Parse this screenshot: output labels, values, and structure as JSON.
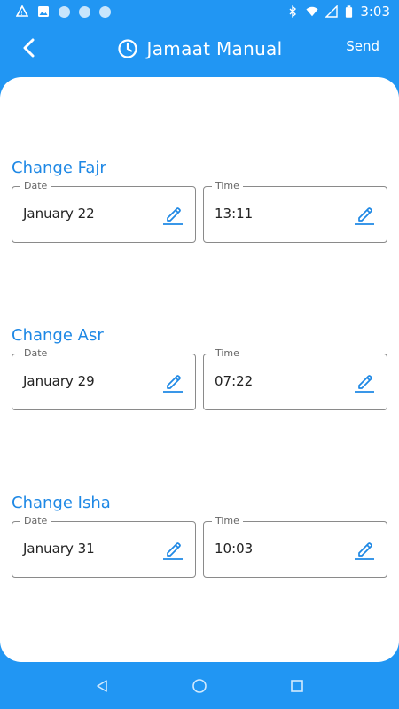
{
  "status_bar": {
    "time": "3:03",
    "icons": [
      "alert-icon",
      "mm-icon",
      "image-icon",
      "circle-icon",
      "circle-icon",
      "circle-icon",
      "bluetooth-icon",
      "wifi-icon",
      "signal-icon",
      "battery-icon"
    ]
  },
  "app_bar": {
    "title": "Jamaat Manual",
    "send_label": "Send"
  },
  "sections": [
    {
      "title": "Change Fajr",
      "date_label": "Date",
      "date_value": "January 22",
      "time_label": "Time",
      "time_value": "13:11"
    },
    {
      "title": "Change Asr",
      "date_label": "Date",
      "date_value": "January 29",
      "time_label": "Time",
      "time_value": "07:22"
    },
    {
      "title": "Change Isha",
      "date_label": "Date",
      "date_value": "January 31",
      "time_label": "Time",
      "time_value": "10:03"
    }
  ],
  "colors": {
    "primary": "#2196F3",
    "accent_text": "#1E88E5",
    "card": "#FFFFFF"
  }
}
